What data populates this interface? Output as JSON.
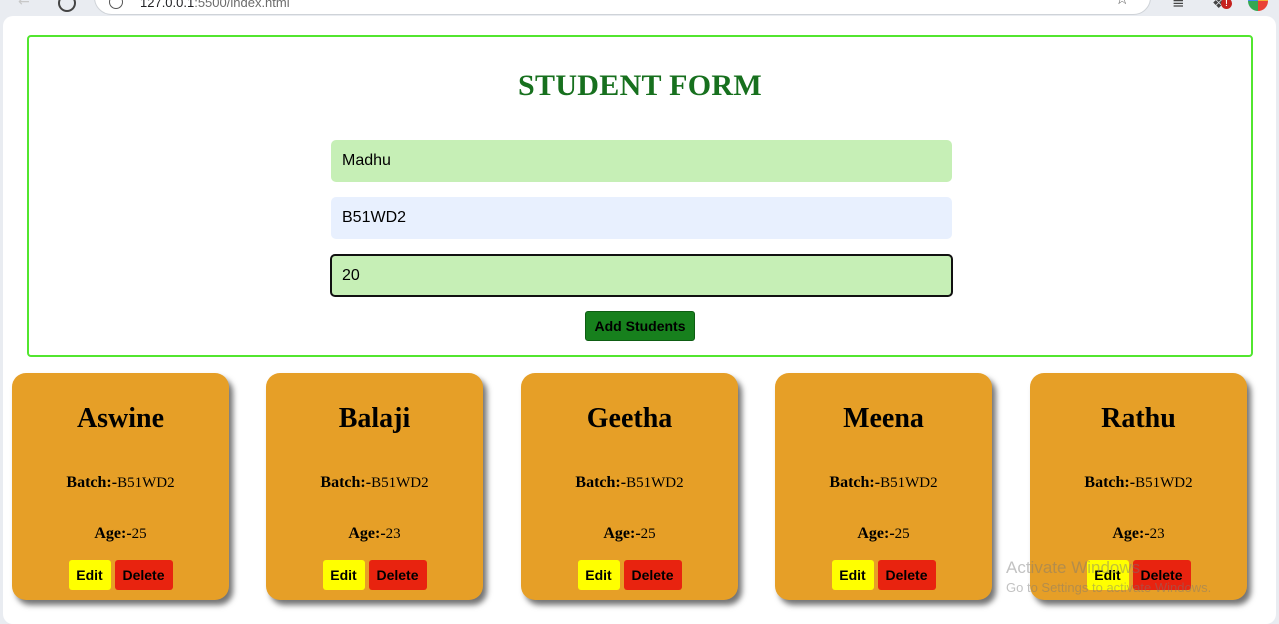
{
  "browser": {
    "url_host": "127.0.0.1",
    "url_rest": ":5500/index.html"
  },
  "form": {
    "title": "STUDENT FORM",
    "name_value": "Madhu",
    "batch_value": "B51WD2",
    "age_value": "20",
    "add_button_label": "Add Students"
  },
  "labels": {
    "batch": "Batch:-",
    "age": "Age:-",
    "edit": "Edit",
    "delete": "Delete"
  },
  "students": [
    {
      "name": "Aswine",
      "batch": "B51WD2",
      "age": "25"
    },
    {
      "name": "Balaji",
      "batch": "B51WD2",
      "age": "23"
    },
    {
      "name": "Geetha",
      "batch": "B51WD2",
      "age": "25"
    },
    {
      "name": "Meena",
      "batch": "B51WD2",
      "age": "25"
    },
    {
      "name": "Rathu",
      "batch": "B51WD2",
      "age": "23"
    }
  ],
  "watermark": {
    "title": "Activate Windows",
    "subtitle": "Go to Settings to activate Windows."
  },
  "colors": {
    "form_border": "#52e62f",
    "title": "#17701e",
    "card_bg": "#e69f27",
    "edit_button": "#ffff00",
    "delete_button": "#e8230f",
    "add_button": "#17801d"
  }
}
